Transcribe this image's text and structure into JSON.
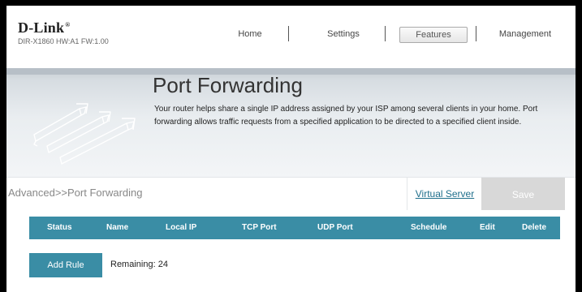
{
  "brand": {
    "logo": "D-Link",
    "logo_mark": "®",
    "model": "DIR-X1860 HW:A1 FW:1.00"
  },
  "nav": {
    "home": "Home",
    "settings": "Settings",
    "features": "Features",
    "management": "Management",
    "active": "features"
  },
  "banner": {
    "title": "Port Forwarding",
    "description": "Your router helps share a single IP address assigned by your ISP among several clients in your home. Port forwarding allows traffic requests from a specified application to be directed to a specified client inside."
  },
  "breadcrumb": "Advanced>>Port Forwarding",
  "actions": {
    "virtual_server": "Virtual Server",
    "save": "Save"
  },
  "table": {
    "columns": [
      "Status",
      "Name",
      "Local IP",
      "TCP Port",
      "UDP Port",
      "Schedule",
      "Edit",
      "Delete"
    ]
  },
  "rules": {
    "add_label": "Add Rule",
    "remaining_label": "Remaining:",
    "remaining_count": "24"
  },
  "colors": {
    "accent": "#3a8da5",
    "link": "#1f6f8c",
    "save_disabled": "#d8d8d8"
  }
}
